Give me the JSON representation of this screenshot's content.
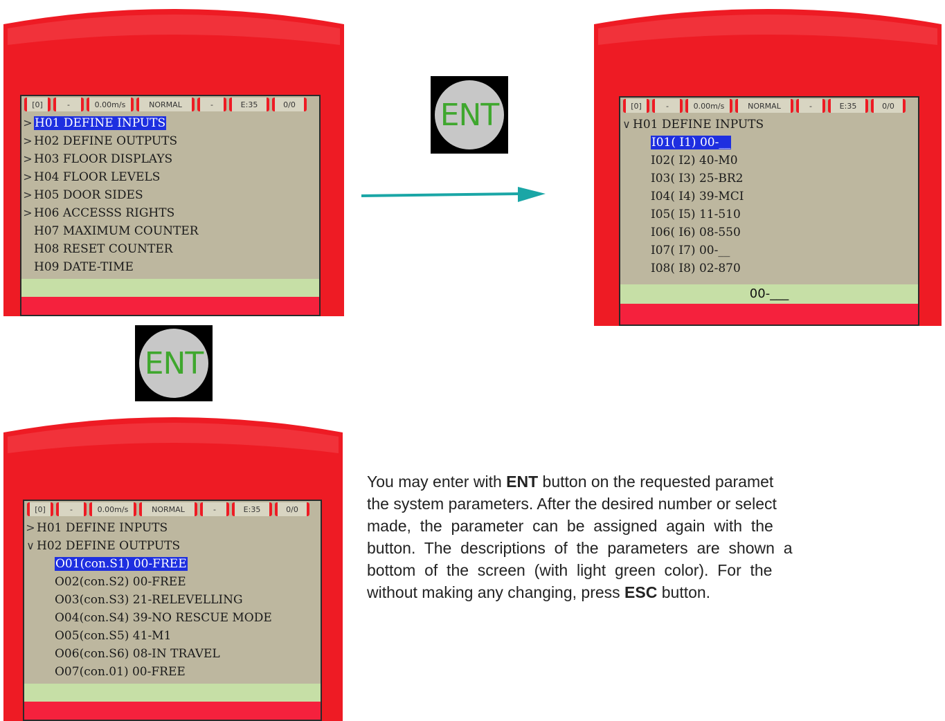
{
  "status": [
    "[0]",
    "-",
    "0.00m/s",
    "NORMAL",
    "-",
    "E:35",
    "0/0"
  ],
  "ent_label": "ENT",
  "colors": {
    "shell_red": "#ee1b24",
    "lcd_bg": "#bdb79f",
    "highlight": "#1e2fe0",
    "desc_bar": "#c6dfa6",
    "arrow": "#1aa6a6",
    "ent_text": "#3fa72e"
  },
  "screen1": {
    "items": [
      {
        "chevron": ">",
        "label": "H01 DEFINE INPUTS",
        "selected": true
      },
      {
        "chevron": ">",
        "label": "H02 DEFINE OUTPUTS",
        "selected": false
      },
      {
        "chevron": ">",
        "label": "H03 FLOOR DISPLAYS",
        "selected": false
      },
      {
        "chevron": ">",
        "label": "H04 FLOOR LEVELS",
        "selected": false
      },
      {
        "chevron": ">",
        "label": "H05 DOOR SIDES",
        "selected": false
      },
      {
        "chevron": ">",
        "label": "H06 ACCESSS RIGHTS",
        "selected": false
      },
      {
        "chevron": "",
        "label": "H07 MAXIMUM COUNTER",
        "selected": false
      },
      {
        "chevron": "",
        "label": "H08 RESET COUNTER",
        "selected": false
      },
      {
        "chevron": "",
        "label": "H09 DATE-TIME",
        "selected": false
      }
    ],
    "description": ""
  },
  "screen2": {
    "header": {
      "chevron": "∨",
      "label": "H01 DEFINE INPUTS"
    },
    "items": [
      {
        "label": "I01( I1) 00-__",
        "selected": true
      },
      {
        "label": "I02( I2) 40-M0",
        "selected": false
      },
      {
        "label": "I03( I3) 25-BR2",
        "selected": false
      },
      {
        "label": "I04( I4) 39-MCI",
        "selected": false
      },
      {
        "label": "I05( I5) 11-510",
        "selected": false
      },
      {
        "label": "I06( I6) 08-550",
        "selected": false
      },
      {
        "label": "I07( I7) 00-__",
        "selected": false
      },
      {
        "label": "I08( I8) 02-870",
        "selected": false
      }
    ],
    "description": "00-___"
  },
  "screen3": {
    "header1": {
      "chevron": ">",
      "label": "H01 DEFINE INPUTS"
    },
    "header2": {
      "chevron": "∨",
      "label": "H02 DEFINE OUTPUTS"
    },
    "items": [
      {
        "label": "O01(con.S1) 00-FREE",
        "selected": true
      },
      {
        "label": "O02(con.S2) 00-FREE",
        "selected": false
      },
      {
        "label": "O03(con.S3) 21-RELEVELLING",
        "selected": false
      },
      {
        "label": "O04(con.S4) 39-NO RESCUE MODE",
        "selected": false
      },
      {
        "label": "O05(con.S5) 41-M1",
        "selected": false
      },
      {
        "label": "O06(con.S6) 08-IN TRAVEL",
        "selected": false
      },
      {
        "label": "O07(con.01) 00-FREE",
        "selected": false
      }
    ],
    "description": ""
  },
  "instructions": {
    "line1_a": "You may enter with ",
    "line1_b": "ENT",
    "line1_c": " button on the requested paramet",
    "line2": "the system parameters. After the desired number or select",
    "line3": "made,  the  parameter  can  be  assigned  again  with  the",
    "line4": "button.  The  descriptions  of  the  parameters  are  shown  a",
    "line5": "bottom  of  the  screen  (with  light  green  color).  For  the",
    "line6_a": "without making any changing, press ",
    "line6_b": "ESC",
    "line6_c": " button."
  }
}
